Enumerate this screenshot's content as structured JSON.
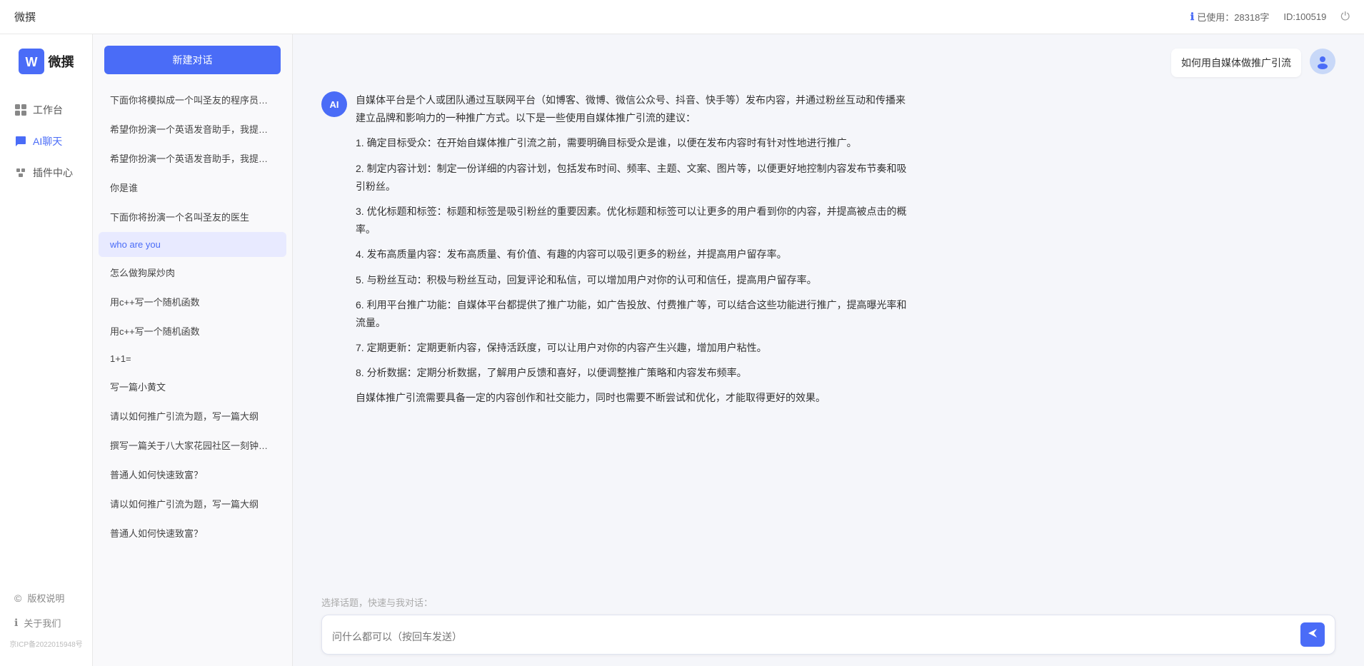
{
  "topbar": {
    "title": "微撰",
    "usage_label": "已使用：28318字",
    "id_label": "ID:100519",
    "usage_icon": "ℹ",
    "power_icon": "⏻"
  },
  "logo": {
    "text": "微撰",
    "icon_char": "W"
  },
  "nav": {
    "items": [
      {
        "id": "workbench",
        "label": "工作台",
        "icon": "⊞"
      },
      {
        "id": "ai-chat",
        "label": "AI聊天",
        "icon": "💬",
        "active": true
      },
      {
        "id": "plugin",
        "label": "插件中心",
        "icon": "🔌"
      }
    ],
    "footer_items": [
      {
        "id": "copyright",
        "label": "版权说明",
        "icon": "©"
      },
      {
        "id": "about",
        "label": "关于我们",
        "icon": "ℹ"
      }
    ],
    "icp": "京ICP备2022015948号"
  },
  "history": {
    "new_btn": "新建对话",
    "items": [
      {
        "id": 1,
        "text": "下面你将模拟成一个叫圣友的程序员，我说...",
        "active": false
      },
      {
        "id": 2,
        "text": "希望你扮演一个英语发音助手，我提供给你...",
        "active": false
      },
      {
        "id": 3,
        "text": "希望你扮演一个英语发音助手，我提供给你...",
        "active": false
      },
      {
        "id": 4,
        "text": "你是谁",
        "active": false
      },
      {
        "id": 5,
        "text": "下面你将扮演一个名叫圣友的医生",
        "active": false
      },
      {
        "id": 6,
        "text": "who are you",
        "active": true
      },
      {
        "id": 7,
        "text": "怎么做狗屎炒肉",
        "active": false
      },
      {
        "id": 8,
        "text": "用c++写一个随机函数",
        "active": false
      },
      {
        "id": 9,
        "text": "用c++写一个随机函数",
        "active": false
      },
      {
        "id": 10,
        "text": "1+1=",
        "active": false
      },
      {
        "id": 11,
        "text": "写一篇小黄文",
        "active": false
      },
      {
        "id": 12,
        "text": "请以如何推广引流为题，写一篇大纲",
        "active": false
      },
      {
        "id": 13,
        "text": "撰写一篇关于八大家花园社区一刻钟便民生...",
        "active": false
      },
      {
        "id": 14,
        "text": "普通人如何快速致富？",
        "active": false
      },
      {
        "id": 15,
        "text": "请以如何推广引流为题，写一篇大纲",
        "active": false
      },
      {
        "id": 16,
        "text": "普通人如何快速致富？",
        "active": false
      }
    ]
  },
  "chat": {
    "user_question": "如何用自媒体做推广引流",
    "ai_response": {
      "paragraphs": [
        "自媒体平台是个人或团队通过互联网平台（如博客、微博、微信公众号、抖音、快手等）发布内容，并通过粉丝互动和传播来建立品牌和影响力的一种推广方式。以下是一些使用自媒体推广引流的建议：",
        "1. 确定目标受众：在开始自媒体推广引流之前，需要明确目标受众是谁，以便在发布内容时有针对性地进行推广。",
        "2. 制定内容计划：制定一份详细的内容计划，包括发布时间、频率、主题、文案、图片等，以便更好地控制内容发布节奏和吸引粉丝。",
        "3. 优化标题和标签：标题和标签是吸引粉丝的重要因素。优化标题和标签可以让更多的用户看到你的内容，并提高被点击的概率。",
        "4. 发布高质量内容：发布高质量、有价值、有趣的内容可以吸引更多的粉丝，并提高用户留存率。",
        "5. 与粉丝互动：积极与粉丝互动，回复评论和私信，可以增加用户对你的认可和信任，提高用户留存率。",
        "6. 利用平台推广功能：自媒体平台都提供了推广功能，如广告投放、付费推广等，可以结合这些功能进行推广，提高曝光率和流量。",
        "7. 定期更新：定期更新内容，保持活跃度，可以让用户对你的内容产生兴趣，增加用户粘性。",
        "8. 分析数据：定期分析数据，了解用户反馈和喜好，以便调整推广策略和内容发布频率。",
        "自媒体推广引流需要具备一定的内容创作和社交能力，同时也需要不断尝试和优化，才能取得更好的效果。"
      ]
    },
    "input_placeholder": "问什么都可以（按回车发送）",
    "quick_topic_label": "选择话题，快速与我对话：",
    "send_icon": "➤"
  }
}
